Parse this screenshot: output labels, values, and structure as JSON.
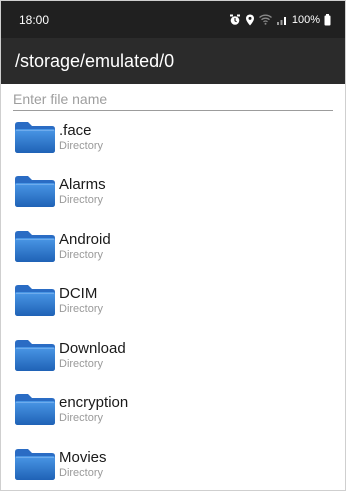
{
  "status_bar": {
    "time": "18:00",
    "battery": "100%",
    "icons": [
      "alarm-icon",
      "location-icon",
      "wifi-icon",
      "signal-icon",
      "battery-icon"
    ]
  },
  "app_bar": {
    "title": "/storage/emulated/0"
  },
  "search": {
    "placeholder": "Enter file name",
    "value": ""
  },
  "items": [
    {
      "name": ".face",
      "type": "Directory",
      "icon": "folder-icon"
    },
    {
      "name": "Alarms",
      "type": "Directory",
      "icon": "folder-icon"
    },
    {
      "name": "Android",
      "type": "Directory",
      "icon": "folder-icon"
    },
    {
      "name": "DCIM",
      "type": "Directory",
      "icon": "folder-icon"
    },
    {
      "name": "Download",
      "type": "Directory",
      "icon": "folder-icon"
    },
    {
      "name": "encryption",
      "type": "Directory",
      "icon": "folder-icon"
    },
    {
      "name": "Movies",
      "type": "Directory",
      "icon": "folder-icon"
    }
  ],
  "colors": {
    "status_bar_bg": "#202020",
    "app_bar_bg": "#2b2b2b",
    "folder_blue": "#2f80d8"
  }
}
